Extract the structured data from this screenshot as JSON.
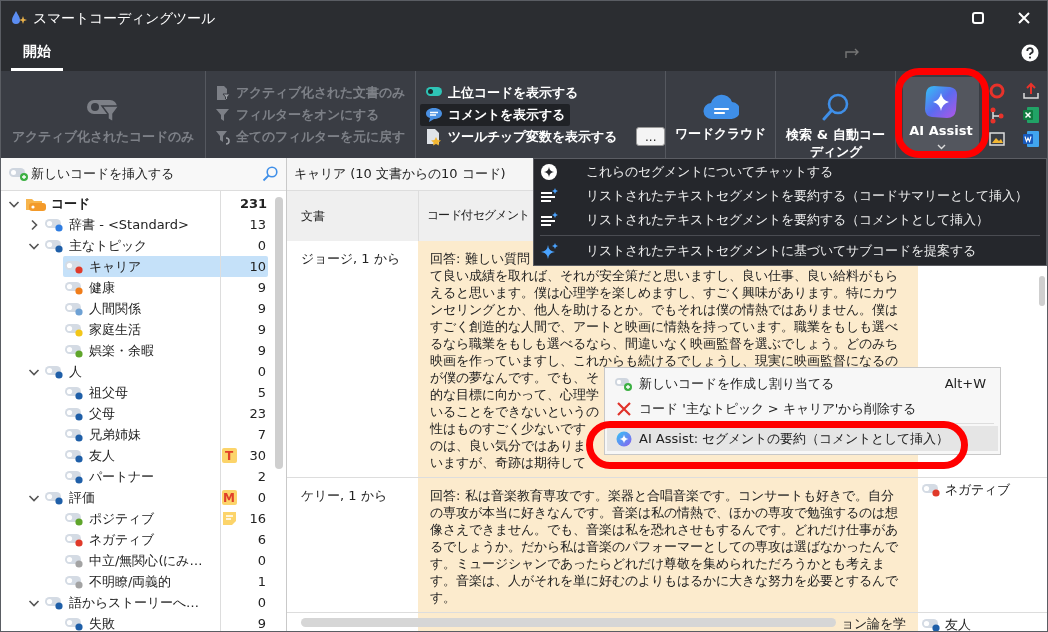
{
  "window": {
    "title": "スマートコーディングツール"
  },
  "tabs": [
    {
      "label": "開始",
      "selected": true
    }
  ],
  "toolbar": {
    "active_codes_button": {
      "label": "アクティブ化されたコードのみ",
      "disabled": true
    },
    "filter_options": [
      {
        "label": "アクティブ化された文書のみ",
        "disabled": true
      },
      {
        "label": "フィルターをオンにする",
        "disabled": true
      },
      {
        "label": "全てのフィルターを元に戻す",
        "disabled": true
      }
    ],
    "display_options": [
      {
        "label": "上位コードを表示する",
        "checked": false
      },
      {
        "label": "コメントを表示する",
        "checked": true
      },
      {
        "label": "ツールチップ変数を表示する",
        "checked": false
      }
    ],
    "more_button": {
      "label": "..."
    },
    "word_cloud_button": {
      "label": "ワードクラウド"
    },
    "search_button": {
      "label": "検索 & 自動コーディング"
    },
    "ai_assist_button": {
      "label": "AI Assist",
      "menu_open": true,
      "highlighted": true
    }
  },
  "new_code_field": {
    "placeholder": "新しいコードを挿入する"
  },
  "code_tree": [
    {
      "label": "コード",
      "count": "231",
      "kind": "folder",
      "expanded": true,
      "selected": false,
      "children": [
        {
          "label": "辞書 - <Standard>",
          "count": "13",
          "kind": "code",
          "color": "#2f7de1",
          "expanded": false,
          "selected": false
        },
        {
          "label": "主なトピック",
          "count": "0",
          "kind": "code",
          "color": "#1f5fa8",
          "expanded": true,
          "selected": false,
          "children": [
            {
              "label": "キャリア",
              "count": "10",
              "kind": "code",
              "color": "#e03a2a",
              "selected": true
            },
            {
              "label": "健康",
              "count": "9",
              "kind": "code",
              "color": "#f07d1a",
              "selected": false
            },
            {
              "label": "人間関係",
              "count": "9",
              "kind": "code",
              "color": "#6ea1d4",
              "selected": false
            },
            {
              "label": "家庭生活",
              "count": "9",
              "kind": "code",
              "color": "#f2c619",
              "selected": false
            },
            {
              "label": "娯楽・余暇",
              "count": "9",
              "kind": "code",
              "color": "#5fa52b",
              "selected": false
            }
          ]
        },
        {
          "label": "人",
          "count": "0",
          "kind": "code",
          "color": "#1f5fa8",
          "expanded": true,
          "selected": false,
          "children": [
            {
              "label": "祖父母",
              "count": "5",
              "kind": "code",
              "color": "#1f5fa8",
              "selected": false
            },
            {
              "label": "父母",
              "count": "23",
              "kind": "code",
              "color": "#1f5fa8",
              "selected": false
            },
            {
              "label": "兄弟姉妹",
              "count": "7",
              "kind": "code",
              "color": "#1f5fa8",
              "selected": false
            },
            {
              "label": "友人",
              "count": "30",
              "kind": "code",
              "color": "#1f5fa8",
              "selected": false,
              "memo": {
                "kind": "letter",
                "label": "T"
              }
            },
            {
              "label": "パートナー",
              "count": "2",
              "kind": "code",
              "color": "#1f5fa8",
              "selected": false
            }
          ]
        },
        {
          "label": "評価",
          "count": "0",
          "kind": "code",
          "color": "#1f5fa8",
          "expanded": true,
          "selected": false,
          "memo": {
            "kind": "letter",
            "label": "M"
          },
          "children": [
            {
              "label": "ポジティブ",
              "count": "16",
              "kind": "code",
              "color": "#5fa52b",
              "selected": false,
              "memo": {
                "kind": "note"
              }
            },
            {
              "label": "ネガティブ",
              "count": "6",
              "kind": "code",
              "color": "#e03a2a",
              "selected": false
            },
            {
              "label": "中立/無関心(にみ…",
              "count": "0",
              "kind": "code",
              "color": "#a3a3a3",
              "selected": false
            },
            {
              "label": "不明瞭/両義的",
              "count": "1",
              "kind": "code",
              "color": "#a3a3a3",
              "selected": false
            }
          ]
        },
        {
          "label": "語からストーリーへ…",
          "count": "0",
          "kind": "code",
          "color": "#1f5fa8",
          "expanded": true,
          "selected": false,
          "children": [
            {
              "label": "失敗",
              "count": "9",
              "kind": "code",
              "color": "#1f5fa8",
              "selected": false
            }
          ]
        }
      ]
    }
  ],
  "segment_view": {
    "title": "キャリア (10 文書からの10 コード)",
    "columns": [
      "文書",
      "コード付セグメント"
    ],
    "rows": [
      {
        "document": "ジョージ, 1 から",
        "segment_lines": [
          "回答: 難しい質問",
          "て良い成績を取れば、それが安全策だと思いますし、良い仕事、良い給料がもら",
          "えると思います。僕は心理学を楽しめますし、すごく興味があります。特にカウ",
          "ンセリングとか、他人を助けるとか。でもそれは僕の情熱ではありません。僕は",
          "すごく創造的な人間で、アートと映画に情熱を持っています。職業をもしも選べ",
          "るなら職業をもしも選べるなら、間違いなく映画監督を選ぶでしょう。どのみち",
          "映画を作っていますし、これからも続けるでしょうし、現実に映画監督になるの",
          "が僕の夢なんです。でも、そ",
          "的な目標に向かって、心理学",
          "いることをできないというの",
          "性はものすごく少ないです",
          "のは、良い気分ではありま",
          "いますが、奇跡は期待して"
        ]
      },
      {
        "document": "ケリー, 1 から",
        "segment_lines": [
          "回答: 私は音楽教育専攻です。楽器と合唱音楽です。コンサートも好きで。自分",
          "の専攻が本当に好きなんです。音楽は私の情熱で、ほかの専攻で勉強するのは想",
          "像さえできません。でも、音楽は私を恐れさせもするんです。どれだけ仕事があ",
          "るでしょうか。だから私は音楽のパフォーマーとしての専攻は選ばなかったんで",
          "す。ミュージシャンであったらどれだけ尊敬を集められただろうかとも考えま",
          "す。音楽は、人がそれを単に好むのよりもはるかに大きな努力を必要とするんで",
          "す。"
        ],
        "codes": [
          {
            "label": "ネガティブ",
            "color": "#e03a2a"
          }
        ]
      },
      {
        "segment_lines": [
          "ョン論を学"
        ],
        "codes": [
          {
            "label": "友人",
            "color": "#1f5fa8"
          }
        ]
      }
    ]
  },
  "ai_menu": {
    "items": [
      {
        "kind": "chat",
        "label": "これらのセグメントについてチャットする",
        "separator_before": false
      },
      {
        "kind": "summary",
        "label": "リストされたテキストセグメントを要約する（コードサマリーとして挿入）",
        "separator_before": false
      },
      {
        "kind": "summary",
        "label": "リストされたテキストセグメントを要約する（コメントとして挿入）",
        "separator_before": false
      },
      {
        "kind": "suggest",
        "label": "リストされたテキストセグメントに基づいてサブコードを提案する",
        "separator_before": true
      }
    ]
  },
  "context_menu": {
    "items": [
      {
        "kind": "new_code",
        "label": "新しいコードを作成し割り当てる",
        "shortcut": "Alt+W",
        "hovered": false,
        "highlighted": false,
        "separator_before": false
      },
      {
        "kind": "remove_code",
        "label": "コード '主なトピック > キャリア'から削除する",
        "hovered": false,
        "highlighted": false,
        "separator_before": false
      },
      {
        "kind": "ai_summary",
        "label": "AI Assist: セグメントの要約（コメントとして挿入）",
        "hovered": true,
        "highlighted": true,
        "separator_before": true
      }
    ]
  }
}
